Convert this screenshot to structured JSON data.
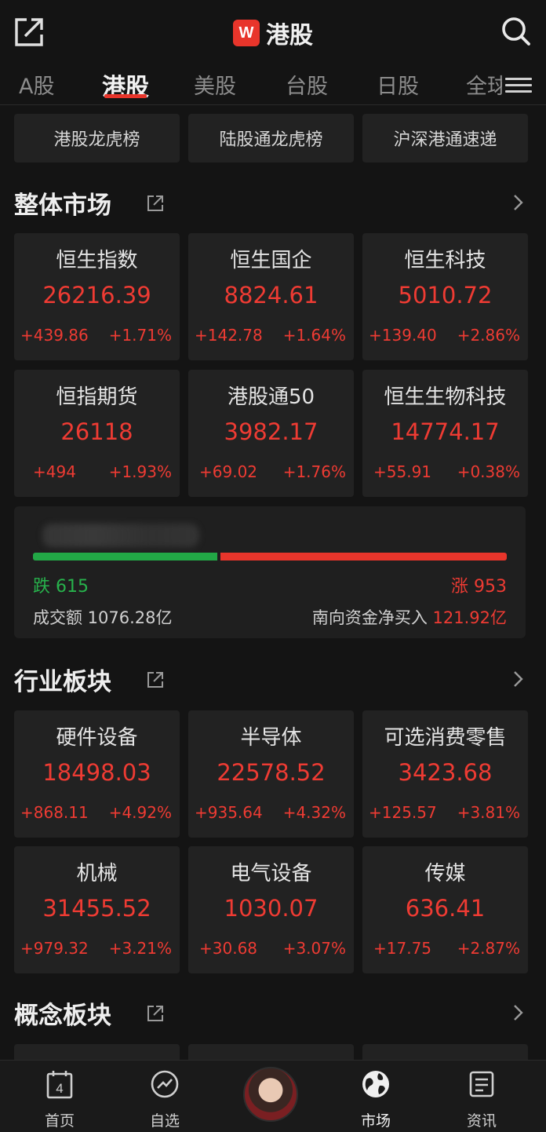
{
  "header": {
    "title": "港股",
    "logo_text": "W"
  },
  "tabs": [
    {
      "label": "A股"
    },
    {
      "label": "港股",
      "active": true
    },
    {
      "label": "美股"
    },
    {
      "label": "台股"
    },
    {
      "label": "日股"
    },
    {
      "label": "全球"
    }
  ],
  "rank_buttons": [
    "港股龙虎榜",
    "陆股通龙虎榜",
    "沪深港通速递"
  ],
  "sections": {
    "market": "整体市场",
    "industry": "行业板块",
    "concept": "概念板块"
  },
  "indices": [
    {
      "name": "恒生指数",
      "value": "26216.39",
      "change": "+439.86",
      "pct": "+1.71%"
    },
    {
      "name": "恒生国企",
      "value": "8824.61",
      "change": "+142.78",
      "pct": "+1.64%"
    },
    {
      "name": "恒生科技",
      "value": "5010.72",
      "change": "+139.40",
      "pct": "+2.86%"
    },
    {
      "name": "恒指期货",
      "value": "26118",
      "change": "+494",
      "pct": "+1.93%"
    },
    {
      "name": "港股通50",
      "value": "3982.17",
      "change": "+69.02",
      "pct": "+1.76%"
    },
    {
      "name": "恒生生物科技",
      "value": "14774.17",
      "change": "+55.91",
      "pct": "+0.38%"
    }
  ],
  "breadth": {
    "fall_label": "跌 615",
    "rise_label": "涨 953",
    "fall_count": 615,
    "rise_count": 953,
    "turnover": "成交额 1076.28亿",
    "southbound_label": "南向资金净买入",
    "southbound_value": "121.92亿"
  },
  "industries": [
    {
      "name": "硬件设备",
      "value": "18498.03",
      "change": "+868.11",
      "pct": "+4.92%"
    },
    {
      "name": "半导体",
      "value": "22578.52",
      "change": "+935.64",
      "pct": "+4.32%"
    },
    {
      "name": "可选消费零售",
      "value": "3423.68",
      "change": "+125.57",
      "pct": "+3.81%"
    },
    {
      "name": "机械",
      "value": "31455.52",
      "change": "+979.32",
      "pct": "+3.21%"
    },
    {
      "name": "电气设备",
      "value": "1030.07",
      "change": "+30.68",
      "pct": "+3.07%"
    },
    {
      "name": "传媒",
      "value": "636.41",
      "change": "+17.75",
      "pct": "+2.87%"
    }
  ],
  "bottom_nav": {
    "home": "首页",
    "watchlist": "自选",
    "market": "市场",
    "news": "资讯",
    "calendar_day": "4"
  },
  "colors": {
    "up": "#ee3b33",
    "down": "#27b24c",
    "accent": "#e8352b"
  }
}
